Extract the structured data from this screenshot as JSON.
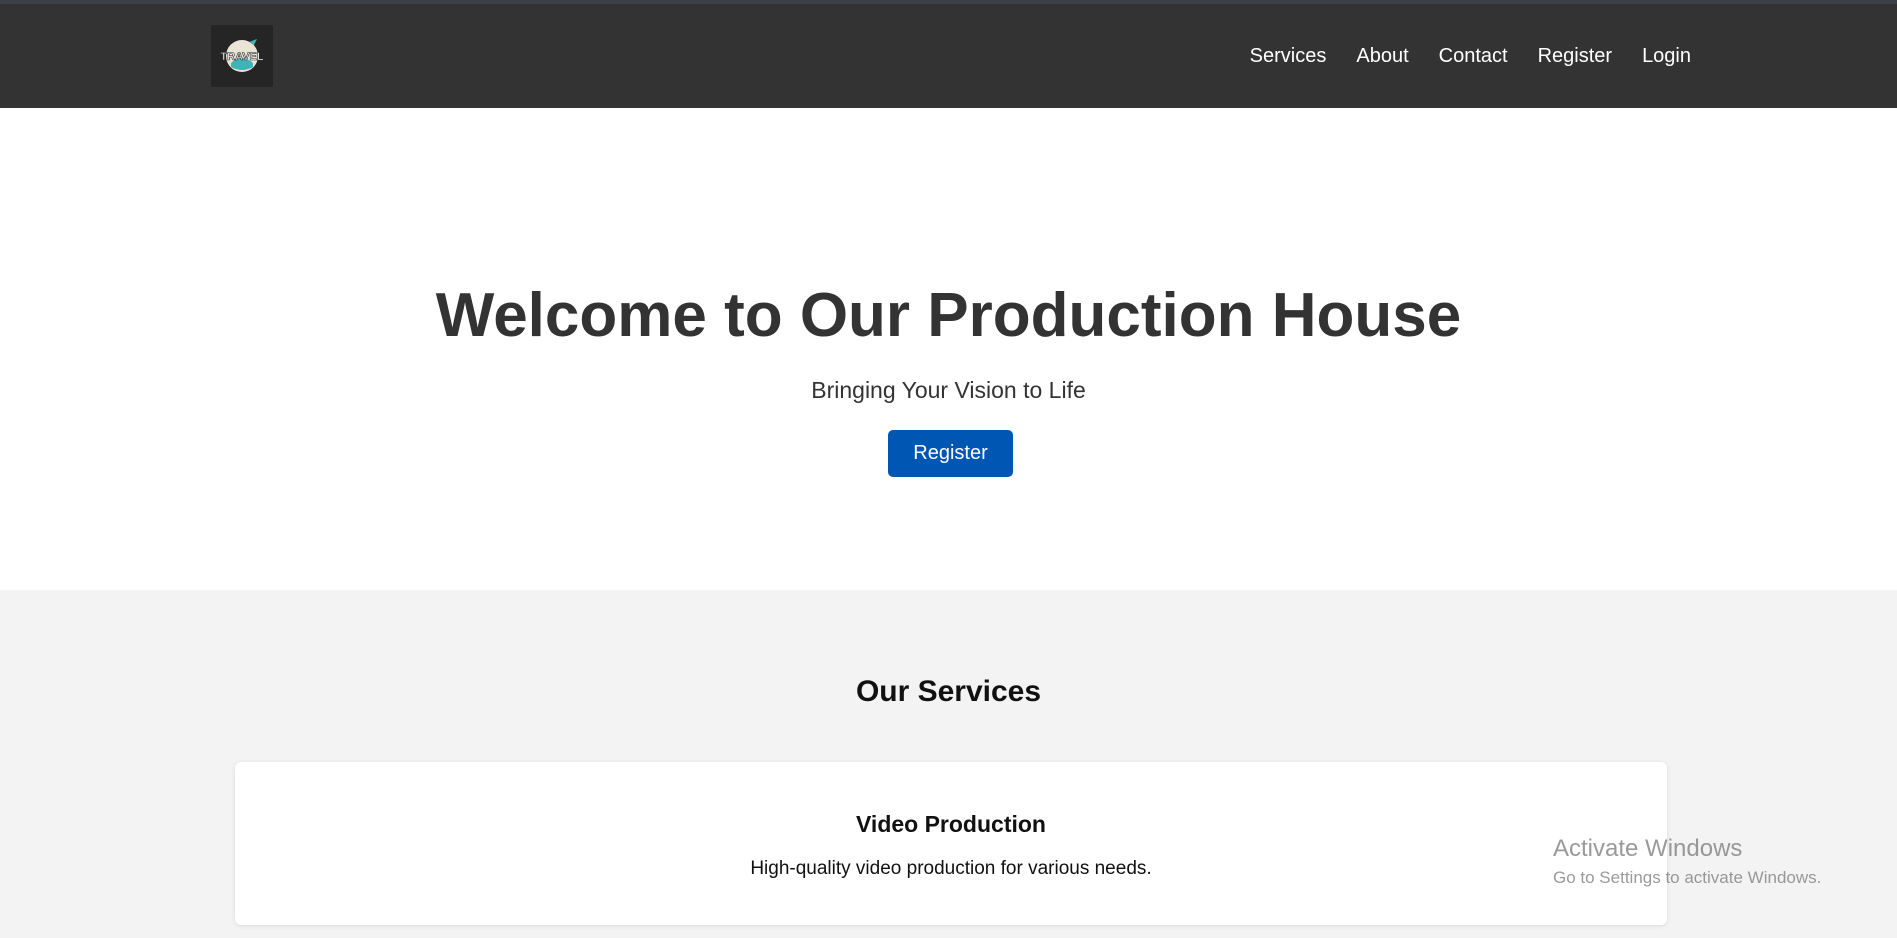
{
  "brand": {
    "logo_icon": "travel-logo",
    "logo_text": "TRAVEL"
  },
  "nav": {
    "items": [
      {
        "label": "Services"
      },
      {
        "label": "About"
      },
      {
        "label": "Contact"
      },
      {
        "label": "Register"
      },
      {
        "label": "Login"
      }
    ]
  },
  "hero": {
    "title": "Welcome to Our Production House",
    "subtitle": "Bringing Your Vision to Life",
    "button_label": "Register"
  },
  "services": {
    "title": "Our Services",
    "cards": [
      {
        "title": "Video Production",
        "description": "High-quality video production for various needs."
      }
    ]
  },
  "os_watermark": {
    "title": "Activate Windows",
    "subtitle": "Go to Settings to activate Windows."
  },
  "colors": {
    "navbar_bg": "#333333",
    "accent_button": "#0056b3",
    "services_bg": "#f3f3f3"
  }
}
